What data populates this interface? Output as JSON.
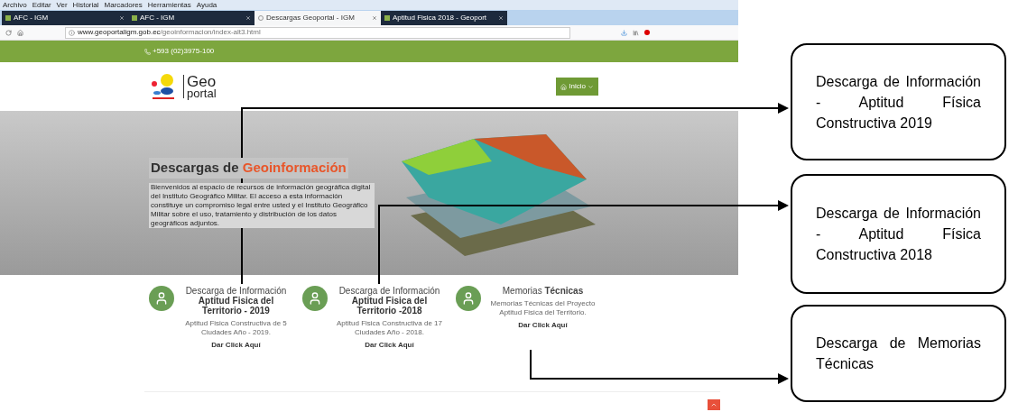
{
  "browser": {
    "menu": [
      "Archivo",
      "Editar",
      "Ver",
      "Historial",
      "Marcadores",
      "Herramientas",
      "Ayuda"
    ],
    "tabs": [
      {
        "title": "AFC - IGM",
        "selected": false
      },
      {
        "title": "AFC - IGM",
        "selected": false
      },
      {
        "title": "Descargas Geoportal - IGM",
        "selected": true
      },
      {
        "title": "Aptitud Fisica 2018 - Geoport",
        "selected": false
      }
    ],
    "url": {
      "host": "www.geoportaligm.gob.ec",
      "path": "/geoinformacion/index-alt3.html"
    }
  },
  "page": {
    "phone": "+593 (02)3975-100",
    "logo": {
      "line1": "Geo",
      "line2": "portal"
    },
    "nav_button": "Inicio",
    "hero": {
      "title": "Descargas de ",
      "title_highlight": "Geoinformación",
      "text": "Bienvenidos al espacio de recursos de información geográfica digital del Instituto Geográfico Militar. El acceso a esta información constituye un compromiso legal entre usted y el Instituto Geográfico Militar sobre el uso, tratamiento y distribución de los datos geográficos adjuntos."
    },
    "cards": [
      {
        "title": "Descarga de Información",
        "subtitle": "Aptitud Fisica del Territorio - 2019",
        "description": "Aptitud Fisica Constructiva de 5 Ciudades Año - 2019.",
        "link": "Dar Click Aquí"
      },
      {
        "title": "Descarga de Información",
        "subtitle": "Aptitud Fisica del Territorio -2018",
        "description": "Aptitud Fisica Constructiva de 17 Ciudades Año - 2018.",
        "link": "Dar Click Aquí"
      },
      {
        "title": "Memorias **Técnicas**",
        "description": "Memorias Técnicas del Proyecto Aptitud Fisica del Territorio.",
        "link": "Dar Click Aquí"
      }
    ]
  },
  "callouts": [
    {
      "text": "Descarga de Información - Aptitud Física Constructiva 2019"
    },
    {
      "text": "Descarga de Información - Aptitud Física Constructiva 2018"
    },
    {
      "text": "Descarga de Memorias Técnicas"
    }
  ]
}
